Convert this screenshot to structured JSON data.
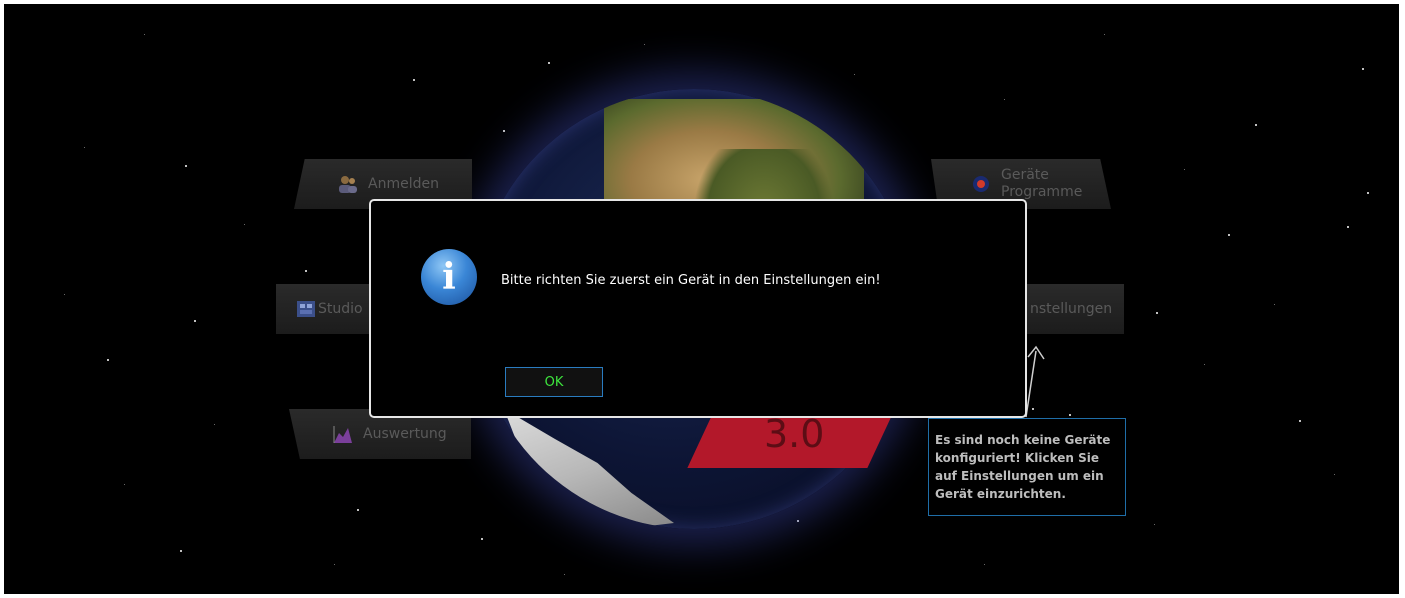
{
  "background": {
    "color": "#000000"
  },
  "menu": {
    "anmelden": "Anmelden",
    "studio": "Studio",
    "auswertung": "Auswertung",
    "geraete_line1": "Geräte",
    "geraete_line2": "Programme",
    "einstellungen": "nstellungen"
  },
  "version_badge": "3.0",
  "hint": {
    "text": "Es sind noch keine Geräte konfiguriert! Klicken Sie auf Einstellungen um ein Gerät einzurichten."
  },
  "dialog": {
    "icon": "info-icon",
    "icon_glyph": "i",
    "message": "Bitte richten Sie zuerst ein Gerät in den Einstellungen ein!",
    "ok_label": "OK"
  },
  "colors": {
    "dialog_border": "#e6e6e6",
    "ok_text": "#3ee63e",
    "ok_border": "#2a7cc0",
    "badge": "#b3182a",
    "hint_border": "#1f6ea8"
  }
}
